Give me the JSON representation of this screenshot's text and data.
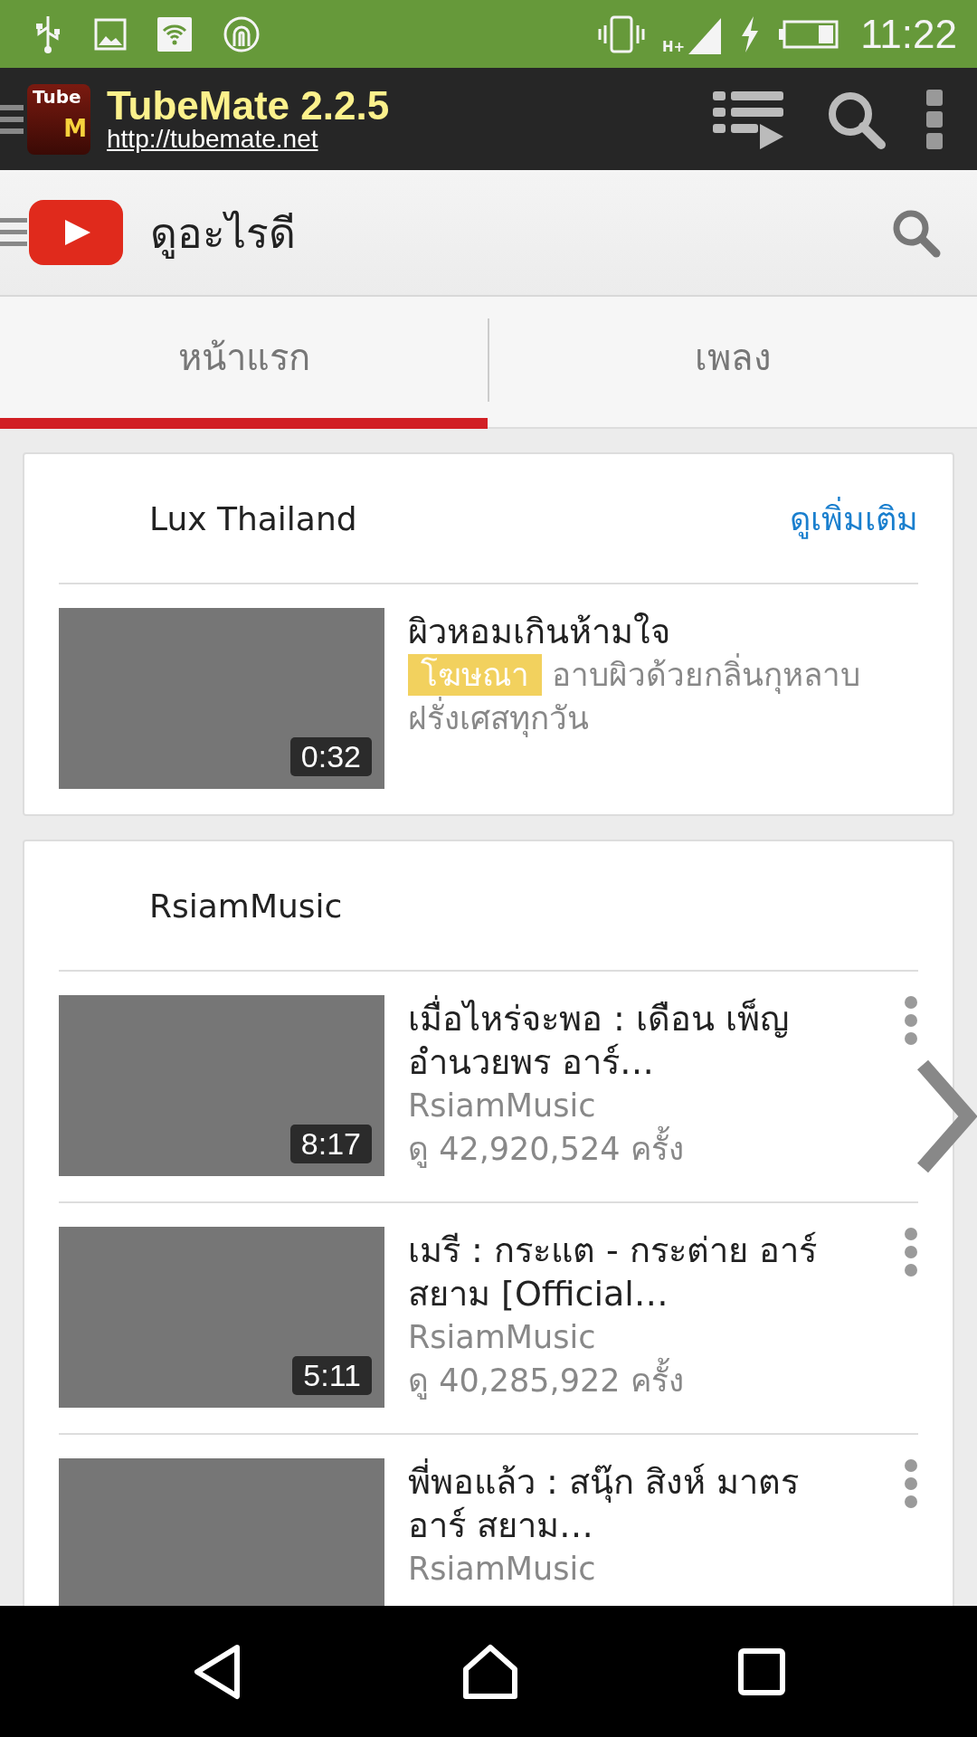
{
  "status_bar": {
    "network_type": "H+",
    "time": "11:22"
  },
  "app_bar": {
    "logo": {
      "top": "Tube",
      "bottom": "M"
    },
    "title": "TubeMate 2.2.5",
    "url": "http://tubemate.net"
  },
  "youtube_bar": {
    "title": "ดูอะไรดี"
  },
  "tabs": [
    {
      "label": "หน้าแรก",
      "selected": true
    },
    {
      "label": "เพลง",
      "selected": false
    }
  ],
  "sections": [
    {
      "channel": "Lux Thailand",
      "more_link": "ดูเพิ่มเติม",
      "videos": [
        {
          "title": "ผิวหอมเกินห้ามใจ",
          "duration": "0:32",
          "ad_badge": "โฆษณา",
          "description": "อาบผิวด้วยกลิ่นกุหลาบฝรั่งเศสทุกวัน"
        }
      ]
    },
    {
      "channel": "RsiamMusic",
      "videos": [
        {
          "title": "เมื่อไหร่จะพอ : เดือน เพ็ญ อำนวยพร อาร์…",
          "duration": "8:17",
          "uploader": "RsiamMusic",
          "views": "ดู 42,920,524 ครั้ง"
        },
        {
          "title": "เมรี : กระแต - กระต่าย อาร์ สยาม [Official…",
          "duration": "5:11",
          "uploader": "RsiamMusic",
          "views": "ดู 40,285,922 ครั้ง"
        },
        {
          "title": "พี่พอแล้ว : สนุ๊ก สิงห์ มาตร อาร์ สยาม…",
          "uploader": "RsiamMusic"
        }
      ]
    }
  ]
}
